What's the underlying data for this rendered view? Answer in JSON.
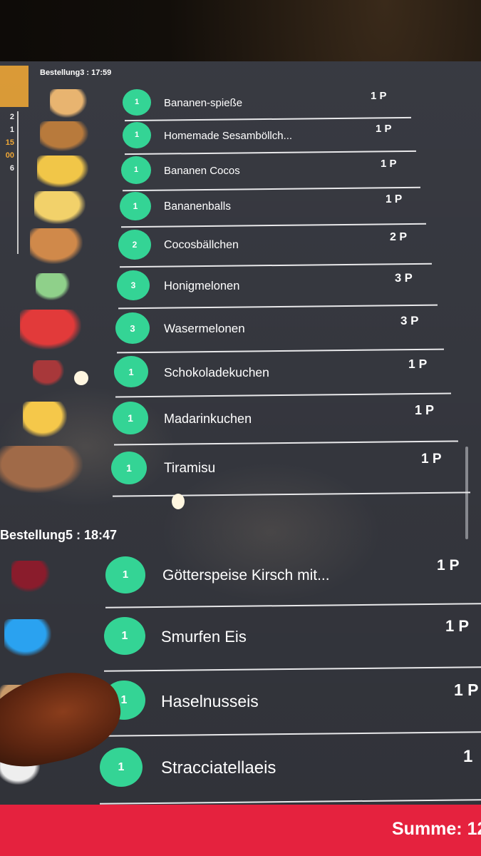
{
  "sidebar": {
    "stats": [
      "2",
      "1",
      "15",
      "00",
      "6"
    ]
  },
  "orders": [
    {
      "header": "Bestellung3 : 17:59",
      "items": [
        {
          "qty": "1",
          "name": "Bananen-spieße",
          "portion": "1 P",
          "thumb_color": "#e8b470"
        },
        {
          "qty": "1",
          "name": "Homemade Sesamböllch...",
          "portion": "1 P",
          "thumb_color": "#b87a3c"
        },
        {
          "qty": "1",
          "name": "Bananen Cocos",
          "portion": "1 P",
          "thumb_color": "#f1c648"
        },
        {
          "qty": "1",
          "name": "Bananenballs",
          "portion": "1 P",
          "thumb_color": "#f2d16a"
        },
        {
          "qty": "2",
          "name": "Cocosbällchen",
          "portion": "2 P",
          "thumb_color": "#d0894a"
        },
        {
          "qty": "3",
          "name": "Honigmelonen",
          "portion": "3 P",
          "thumb_color": "#8fd08a"
        },
        {
          "qty": "3",
          "name": "Wasermelonen",
          "portion": "3 P",
          "thumb_color": "#e23a3a"
        },
        {
          "qty": "1",
          "name": "Schokoladekuchen",
          "portion": "1 P",
          "thumb_color": "#a8383a"
        },
        {
          "qty": "1",
          "name": "Madarinkuchen",
          "portion": "1 P",
          "thumb_color": "#f5c84a"
        },
        {
          "qty": "1",
          "name": "Tiramisu",
          "portion": "1 P",
          "thumb_color": "#a06a48"
        }
      ]
    },
    {
      "header": "Bestellung5 : 18:47",
      "items": [
        {
          "qty": "1",
          "name": "Götterspeise Kirsch mit...",
          "portion": "1 P",
          "thumb_color": "#8a1c2c"
        },
        {
          "qty": "1",
          "name": "Smurfen Eis",
          "portion": "1 P",
          "thumb_color": "#2aa2f0"
        },
        {
          "qty": "1",
          "name": "Haselnusseis",
          "portion": "1 P",
          "thumb_color": "#c89a6a"
        },
        {
          "qty": "1",
          "name": "Stracciatellaeis",
          "portion": "1",
          "thumb_color": "#eeeeee"
        }
      ]
    }
  ],
  "footer": {
    "sum_label": "Summe: 12"
  },
  "colors": {
    "qty_badge": "#34d495",
    "footer": "#e5223e",
    "accent": "#e6a33a"
  }
}
